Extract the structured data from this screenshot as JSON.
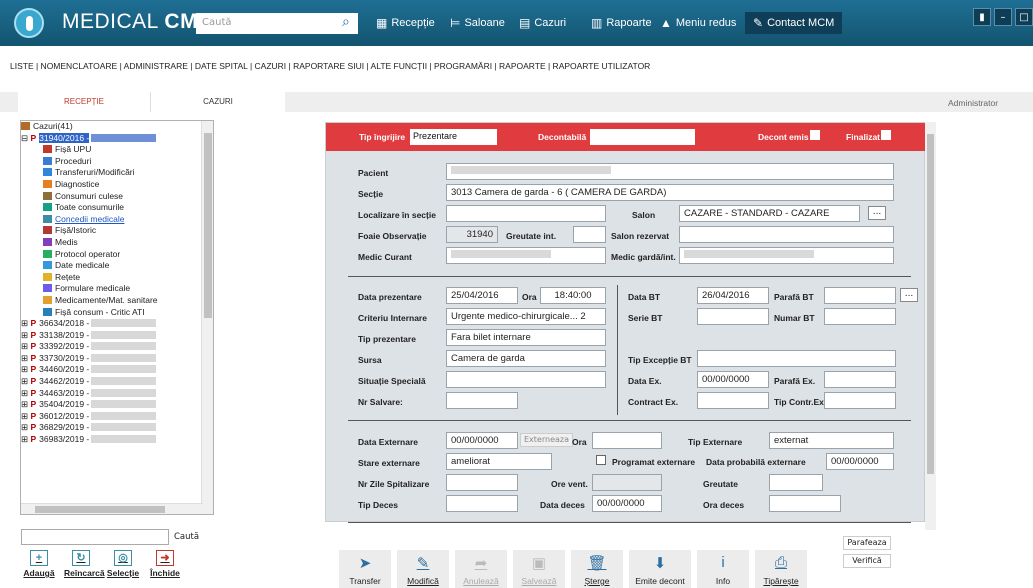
{
  "app": {
    "brand_a": "MEDICAL ",
    "brand_b": "CM",
    "search_placeholder": "Caută"
  },
  "topmenu": [
    {
      "icon": "calendar-icon",
      "label": "Recepție"
    },
    {
      "icon": "bed-icon",
      "label": "Saloane"
    },
    {
      "icon": "clipboard-icon",
      "label": "Cazuri"
    },
    {
      "icon": "chart-icon",
      "label": "Rapoarte"
    },
    {
      "icon": "triangle-up-icon",
      "label": "Meniu redus"
    },
    {
      "icon": "edit-icon",
      "label": "Contact MCM"
    }
  ],
  "tray": [
    "▮",
    "–",
    "□"
  ],
  "menu": "LISTE | NOMENCLATOARE | ADMINISTRARE | DATE SPITAL | CAZURI | RAPORTARE SIUI | ALTE FUNCȚII | PROGRAMĂRI | RAPOARTE | RAPOARTE UTILIZATOR",
  "tabs": {
    "reception": "RECEPȚIE",
    "cases": "CAZURI"
  },
  "user": "Administrator",
  "tree": {
    "root": "Cazuri(41)",
    "selected": "31940/2016 -",
    "children": [
      "Fișă UPU",
      "Proceduri",
      "Transferuri/Modificări",
      "Diagnostice",
      "Consumuri culese",
      "Toate consumurile",
      "Concedii medicale",
      "Fișă/Istoric",
      "Medis",
      "Protocol operator",
      "Date medicale",
      "Rețete",
      "Formulare medicale",
      "Medicamente/Mat. sanitare",
      "Fișă consum - Critic ATI"
    ],
    "cases": [
      "36634/2018 -",
      "33138/2019 -",
      "33392/2019 -",
      "33730/2019 -",
      "34460/2019 -",
      "34462/2019 -",
      "34463/2019 -",
      "35404/2019 -",
      "36012/2019 -",
      "36829/2019 -",
      "36983/2019 -"
    ]
  },
  "tree_search": {
    "button": "Caută"
  },
  "tree_buttons": [
    {
      "icon": "plus-icon",
      "label": "Adaugă"
    },
    {
      "icon": "refresh-icon",
      "label": "Reîncarcă"
    },
    {
      "icon": "select-icon",
      "label": "Selecție"
    },
    {
      "icon": "exit-icon",
      "label": "Închide"
    }
  ],
  "form": {
    "header": {
      "tip_label": "Tip îngrijire",
      "tip_value": "Prezentare",
      "decontabila": "Decontabilă",
      "decont_emis": "Decont emis",
      "finalizat": "Finalizat"
    },
    "pacient": "Pacient",
    "sectie": "Secție",
    "sectie_val": "3013 Camera de garda - 6 ( CAMERA DE GARDA)",
    "localizare": "Localizare în secție",
    "salon": "Salon",
    "salon_val": "CAZARE - STANDARD - CAZARE",
    "foaie": "Foaie Observație",
    "foaie_val": "31940",
    "greutate_int": "Greutate int.",
    "salon_rez": "Salon rezervat",
    "medic_curant": "Medic Curant",
    "medic_garda": "Medic gardă/int.",
    "data_prez": "Data prezentare",
    "data_prez_val": "25/04/2016",
    "ora": "Ora",
    "ora_val": "18:40:00",
    "criteriu": "Criteriu Internare",
    "criteriu_val": "Urgente medico-chirurgicale... 2",
    "tip_prez": "Tip prezentare",
    "tip_prez_val": "Fara bilet internare",
    "sursa": "Sursa",
    "sursa_val": "Camera de garda",
    "situatie": "Situație Specială",
    "nr_salvare": "Nr Salvare:",
    "data_bt": "Data BT",
    "data_bt_val": "26/04/2016",
    "parafa_bt": "Parafă BT",
    "serie_bt": "Serie BT",
    "numar_bt": "Numar BT",
    "tip_exc": "Tip Excepție BT",
    "data_ex": "Data Ex.",
    "data_ex_val": "00/00/0000",
    "parafa_ex": "Parafă Ex.",
    "contract_ex": "Contract Ex.",
    "tip_contr": "Tip Contr.Ex.",
    "data_ext": "Data Externare",
    "data_ext_val": "00/00/0000",
    "externeaza": "Externeaza",
    "ora2": "Ora",
    "tip_ext": "Tip Externare",
    "tip_ext_val": "externat",
    "stare": "Stare externare",
    "stare_val": "ameliorat",
    "programat": "Programat externare",
    "data_prob": "Data probabilă externare",
    "data_prob_val": "00/00/0000",
    "nr_zile": "Nr Zile Spitalizare",
    "ore_vent": "Ore vent.",
    "greutate": "Greutate",
    "tip_deces": "Tip Deces",
    "data_deces": "Data deces",
    "data_deces_val": "00/00/0000",
    "ora_deces": "Ora deces"
  },
  "side_buttons": {
    "parafeaza": "Parafeaza",
    "verifica": "Verifică"
  },
  "bottom": [
    {
      "icon": "send-icon",
      "label": "Transfer",
      "glyph": "➤"
    },
    {
      "icon": "edit-icon",
      "label": "Modifică",
      "glyph": "✎"
    },
    {
      "icon": "undo-icon",
      "label": "Anulează",
      "glyph": "➦"
    },
    {
      "icon": "save-icon",
      "label": "Salvează",
      "glyph": "▣"
    },
    {
      "icon": "trash-icon",
      "label": "Șterge",
      "glyph": "🗑"
    },
    {
      "icon": "decont-icon",
      "label": "Emite decont",
      "glyph": "⬇"
    },
    {
      "icon": "info-icon",
      "label": "Info",
      "glyph": "i"
    },
    {
      "icon": "print-icon",
      "label": "Tipărește",
      "glyph": "⎙"
    }
  ]
}
